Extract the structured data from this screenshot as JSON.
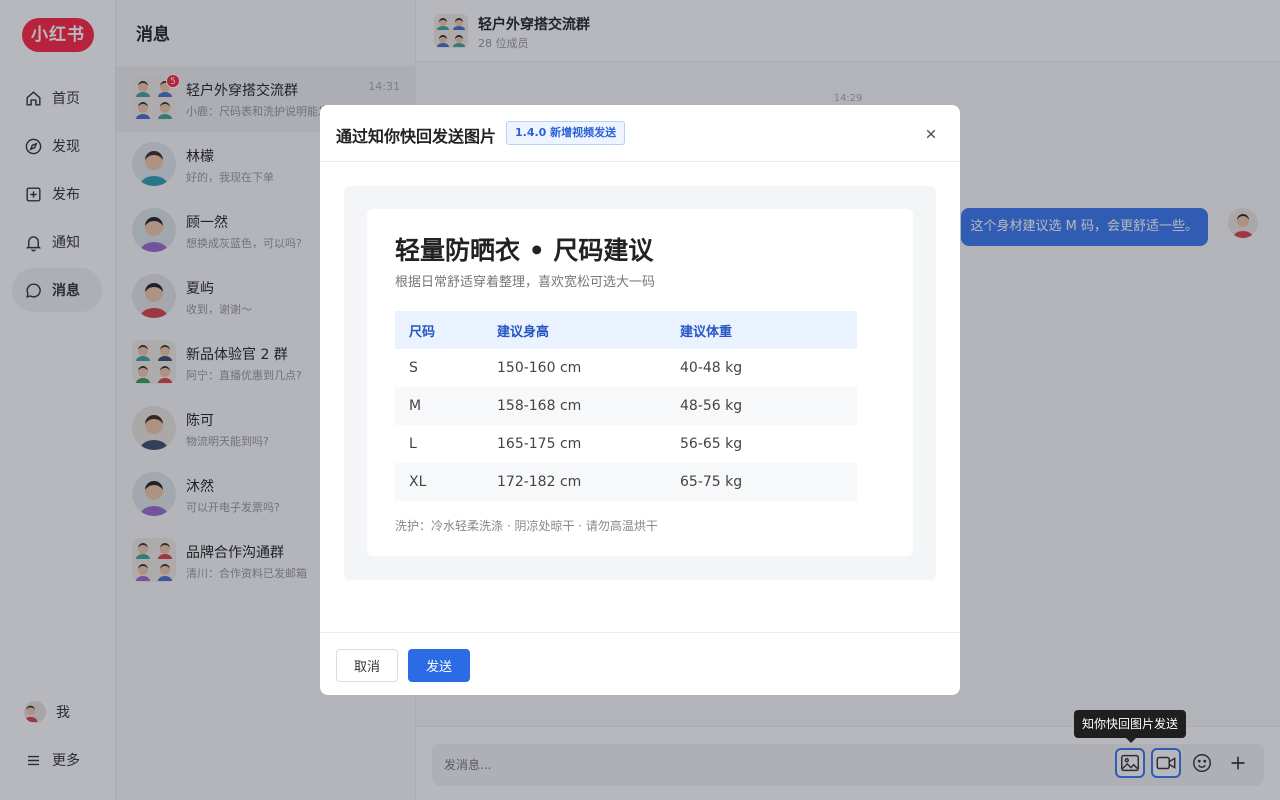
{
  "nav": {
    "logo": "小红书",
    "items": [
      {
        "label": "首页",
        "icon": "home-icon"
      },
      {
        "label": "发现",
        "icon": "compass-icon"
      },
      {
        "label": "发布",
        "icon": "plus-square-icon"
      },
      {
        "label": "通知",
        "icon": "bell-icon"
      },
      {
        "label": "消息",
        "icon": "chat-icon"
      }
    ],
    "me": "我",
    "more": "更多"
  },
  "list": {
    "title": "消息",
    "conversations": [
      {
        "name": "轻户外穿搭交流群",
        "preview": "小鹿：尺码表和洗护说明能发一下吗？",
        "time": "14:31",
        "badge": "5"
      },
      {
        "name": "林檬",
        "preview": "好的，我现在下单"
      },
      {
        "name": "顾一然",
        "preview": "想换成灰蓝色，可以吗?"
      },
      {
        "name": "夏屿",
        "preview": "收到，谢谢～"
      },
      {
        "name": "新品体验官 2 群",
        "preview": "阿宁：直播优惠到几点?"
      },
      {
        "name": "陈可",
        "preview": "物流明天能到吗?"
      },
      {
        "name": "沐然",
        "preview": "可以开电子发票吗?"
      },
      {
        "name": "品牌合作沟通群",
        "preview": "清川：合作资料已发邮箱"
      }
    ]
  },
  "chat": {
    "title": "轻户外穿搭交流群",
    "members": "28 位成员",
    "timestamp": "14:29",
    "message": "这个身材建议选 M 码，会更舒适一些。",
    "input_placeholder": "发消息...",
    "tooltip": "知你快回图片发送"
  },
  "modal": {
    "title": "通过知你快回发送图片",
    "tag": "1.4.0 新增视频发送",
    "card": {
      "title": "轻量防晒衣 • 尺码建议",
      "subtitle": "根据日常舒适穿着整理，喜欢宽松可选大一码",
      "headers": [
        "尺码",
        "建议身高",
        "建议体重"
      ],
      "rows": [
        [
          "S",
          "150-160 cm",
          "40-48 kg"
        ],
        [
          "M",
          "158-168 cm",
          "48-56 kg"
        ],
        [
          "L",
          "165-175 cm",
          "56-65 kg"
        ],
        [
          "XL",
          "172-182 cm",
          "65-75 kg"
        ]
      ],
      "care": "洗护：冷水轻柔洗涤 · 阴凉处晾干 · 请勿高温烘干"
    },
    "cancel": "取消",
    "send": "发送"
  }
}
